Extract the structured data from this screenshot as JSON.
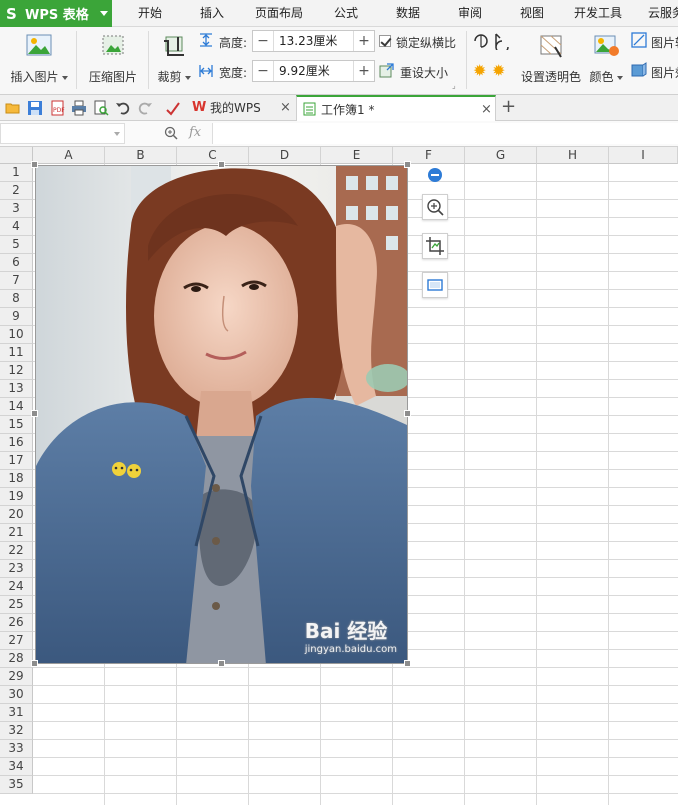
{
  "app": {
    "title": "WPS 表格",
    "brand_color": "#3ba539"
  },
  "menu": {
    "items": [
      "开始",
      "插入",
      "页面布局",
      "公式",
      "数据",
      "审阅",
      "视图",
      "开发工具",
      "云服务"
    ]
  },
  "ribbon": {
    "insert_picture": "插入图片",
    "compress_picture": "压缩图片",
    "crop": "裁剪",
    "height_label": "高度:",
    "height_value": "13.23厘米",
    "width_label": "宽度:",
    "width_value": "9.92厘米",
    "lock_ratio": "锁定纵横比",
    "reset_size": "重设大小",
    "set_transparent": "设置透明色",
    "color": "颜色",
    "picture_outline": "图片轮廓",
    "picture_effect": "图片效果"
  },
  "tabs": [
    {
      "label": "我的WPS",
      "active": false
    },
    {
      "label": "工作簿1 *",
      "active": true
    }
  ],
  "formula_bar": {
    "fx": "fx"
  },
  "sheet": {
    "columns": [
      "A",
      "B",
      "C",
      "D",
      "E",
      "F",
      "G",
      "H",
      "I"
    ],
    "rows": [
      "1",
      "2",
      "3",
      "4",
      "5",
      "6",
      "7",
      "8",
      "9",
      "10",
      "11",
      "12",
      "13",
      "14",
      "15",
      "16",
      "17",
      "18",
      "19",
      "20",
      "21",
      "22",
      "23",
      "24",
      "25",
      "26",
      "27",
      "28",
      "29",
      "30",
      "31",
      "32",
      "33",
      "34",
      "35"
    ]
  },
  "watermark": {
    "main": "Bai 经验",
    "sub": "jingyan.baidu.com"
  }
}
